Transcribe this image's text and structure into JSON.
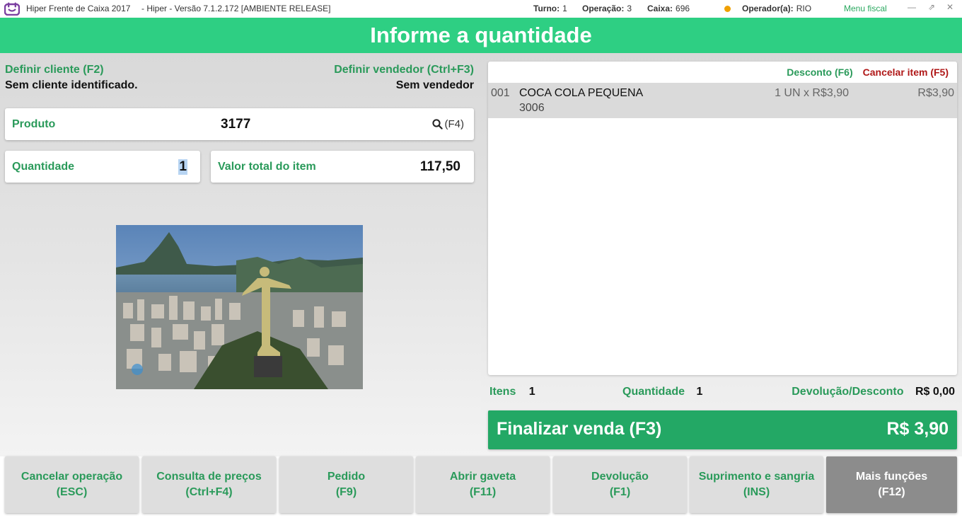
{
  "titlebar": {
    "app_name": "Hiper Frente de Caixa 2017",
    "version": "-    Hiper - Versão 7.1.2.172 [AMBIENTE RELEASE]",
    "turno_label": "Turno:",
    "turno_value": "1",
    "operacao_label": "Operação:",
    "operacao_value": "3",
    "caixa_label": "Caixa:",
    "caixa_value": "696",
    "operador_label": "Operador(a):",
    "operador_value": "RIO",
    "menu_fiscal": "Menu fiscal",
    "minimize": "—",
    "popout": "⇗",
    "close": "✕"
  },
  "banner": {
    "title": "Informe a quantidade"
  },
  "customer": {
    "define_label": "Definir cliente (F2)",
    "status": "Sem cliente identificado."
  },
  "seller": {
    "define_label": "Definir vendedor (Ctrl+F3)",
    "status": "Sem vendedor"
  },
  "product_field": {
    "label": "Produto",
    "value": "3177",
    "search_hint": "(F4)"
  },
  "quantity_field": {
    "label": "Quantidade",
    "value": "1"
  },
  "item_total_field": {
    "label": "Valor total do item",
    "value": "117,50"
  },
  "items_panel": {
    "discount_action": "Desconto (F6)",
    "cancel_action": "Cancelar item (F5)",
    "rows": [
      {
        "number": "001",
        "name": "COCA COLA PEQUENA",
        "code": "3006",
        "qty_price": "1 UN x R$3,90",
        "total": "R$3,90"
      }
    ]
  },
  "summary": {
    "items_label": "Itens",
    "items_value": "1",
    "quantity_label": "Quantidade",
    "quantity_value": "1",
    "refund_label": "Devolução/Desconto",
    "refund_value": "R$ 0,00"
  },
  "finalize": {
    "label": "Finalizar venda (F3)",
    "total": "R$ 3,90"
  },
  "function_buttons": [
    {
      "line1": "Cancelar operação",
      "line2": "(ESC)"
    },
    {
      "line1": "Consulta de preços",
      "line2": "(Ctrl+F4)"
    },
    {
      "line1": "Pedido",
      "line2": "(F9)"
    },
    {
      "line1": "Abrir gaveta",
      "line2": "(F11)"
    },
    {
      "line1": "Devolução",
      "line2": "(F1)"
    },
    {
      "line1": "Suprimento e sangria",
      "line2": "(INS)"
    },
    {
      "line1": "Mais funções",
      "line2": "(F12)"
    }
  ],
  "colors": {
    "brand_green": "#2ecf83",
    "finalize_green": "#23a865",
    "label_green": "#2a9a5a",
    "cancel_red": "#b01818",
    "status_dot": "#f0a000"
  },
  "icons": {
    "app_logo": "hiper-logo-icon",
    "search": "search-icon"
  }
}
